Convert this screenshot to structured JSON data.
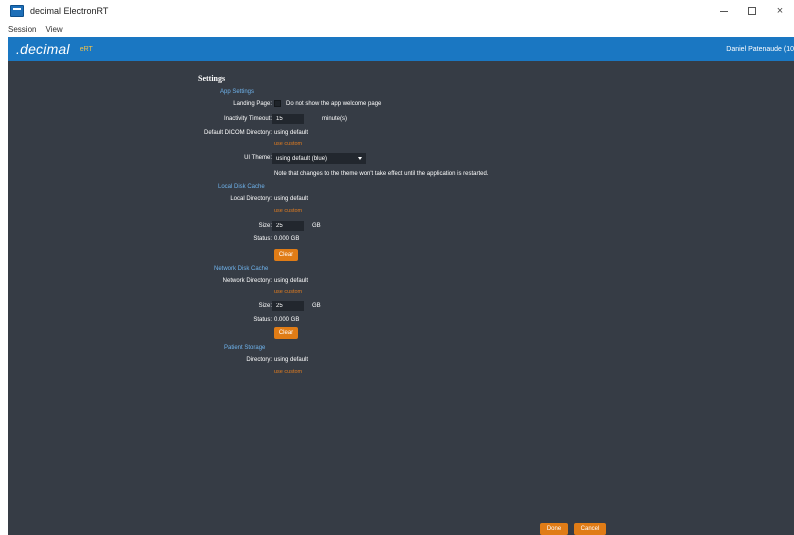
{
  "window": {
    "title": "decimal ElectronRT",
    "controls": {
      "minimize": "–",
      "maximize": "□",
      "close": "×"
    }
  },
  "menu": {
    "items": [
      "Session",
      "View"
    ]
  },
  "brand": {
    "logo": ".decimal",
    "sub": "eRT",
    "user": "Daniel Patenaude (10"
  },
  "settings": {
    "title": "Settings",
    "app_settings": {
      "heading": "App Settings",
      "landing_page_label": "Landing Page:",
      "landing_page_checkbox_label": "Do not show the app welcome page",
      "inactivity_label": "Inactivity Timeout:",
      "inactivity_value": "15",
      "inactivity_unit": "minute(s)",
      "dicom_label": "Default DICOM Directory:",
      "dicom_value": "using default",
      "dicom_link": "use custom",
      "theme_label": "UI Theme:",
      "theme_value": "using default (blue)",
      "theme_note": "Note that changes to the theme won't take effect until the application is restarted."
    },
    "local_cache": {
      "heading": "Local Disk Cache",
      "dir_label": "Local Directory:",
      "dir_value": "using default",
      "dir_link": "use custom",
      "size_label": "Size:",
      "size_value": "25",
      "size_unit": "GB",
      "status_label": "Status:",
      "status_value": "0.000 GB",
      "clear_label": "Clear"
    },
    "network_cache": {
      "heading": "Network Disk Cache",
      "dir_label": "Network Directory:",
      "dir_value": "using default",
      "dir_link": "use custom",
      "size_label": "Size:",
      "size_value": "25",
      "size_unit": "GB",
      "status_label": "Status:",
      "status_value": "0.000 GB",
      "clear_label": "Clear"
    },
    "patient_storage": {
      "heading": "Patient Storage",
      "dir_label": "Directory:",
      "dir_value": "using default",
      "dir_link": "use custom"
    },
    "footer": {
      "done_label": "Done",
      "cancel_label": "Cancel"
    }
  },
  "colors": {
    "brand_blue": "#1a77c2",
    "panel_bg": "#363c45",
    "section_head": "#6fb3ec",
    "accent_orange": "#e07c16"
  }
}
